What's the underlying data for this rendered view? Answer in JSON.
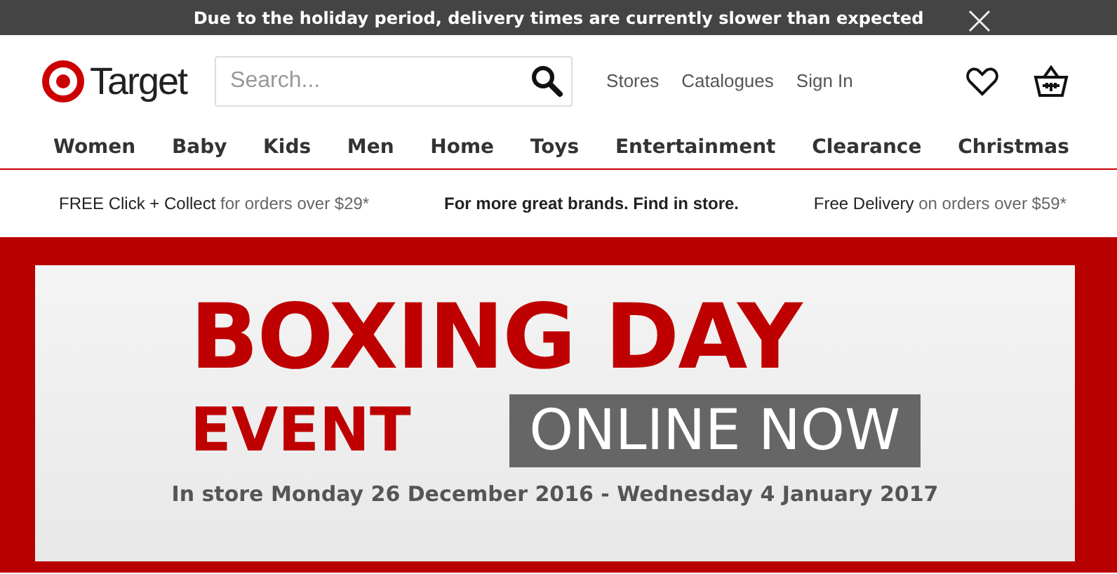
{
  "notice": {
    "text": "Due to the holiday period, delivery times are currently slower than expected"
  },
  "header": {
    "logo_text": "Target",
    "search": {
      "placeholder": "Search..."
    },
    "links": [
      "Stores",
      "Catalogues",
      "Sign In"
    ]
  },
  "nav": [
    "Women",
    "Baby",
    "Kids",
    "Men",
    "Home",
    "Toys",
    "Entertainment",
    "Clearance",
    "Christmas"
  ],
  "promos": [
    {
      "lead": "FREE Click + Collect",
      "rest": "for orders over $29*",
      "kind": "split"
    },
    {
      "lead": "For more great brands. Find in store.",
      "kind": "bold"
    },
    {
      "lead": "Free Delivery",
      "rest": "on orders over $59*",
      "kind": "split"
    }
  ],
  "banner": {
    "title": "BOXING DAY",
    "subtitle": "EVENT",
    "tag": "ONLINE NOW",
    "dates": "In store Monday 26 December 2016 - Wednesday 4 January 2017"
  }
}
